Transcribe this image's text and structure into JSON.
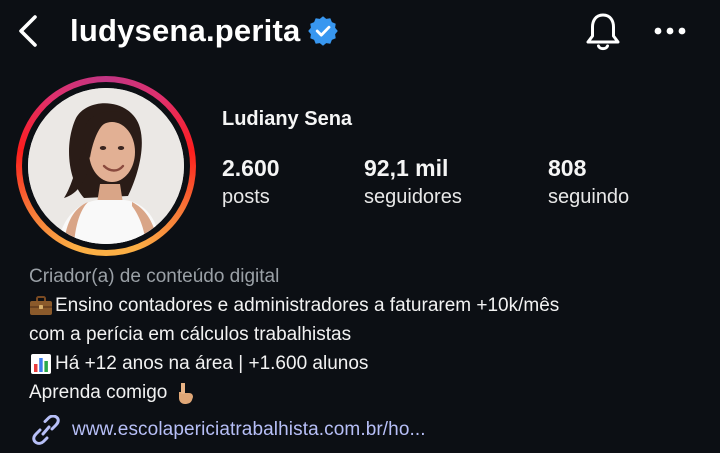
{
  "header": {
    "username": "ludysena.perita",
    "verified": true,
    "icons": [
      "back-arrow-icon",
      "verified-badge-icon",
      "bell-icon",
      "more-options-icon"
    ]
  },
  "profile": {
    "display_name": "Ludiany Sena",
    "stats": {
      "posts": {
        "value": "2.600",
        "label": "posts"
      },
      "followers": {
        "value": "92,1 mil",
        "label": "seguidores"
      },
      "following": {
        "value": "808",
        "label": "seguindo"
      }
    }
  },
  "bio": {
    "category": "Criador(a) de conteúdo digital",
    "lines": [
      {
        "emoji": "briefcase-icon",
        "text": "Ensino contadores e administradores a faturarem +10k/mês"
      },
      {
        "emoji": "",
        "text": "com a perícia em cálculos trabalhistas"
      },
      {
        "emoji": "bar-chart-icon",
        "text": "Há +12 anos na área | +1.600 alunos"
      },
      {
        "emoji": "",
        "text": "Aprenda comigo"
      }
    ],
    "pointing_emoji": "pointing-down-icon",
    "link": "www.escolapericiatrabalhista.com.br/ho..."
  },
  "colors": {
    "background": "#0c0f14",
    "verified_blue": "#3897f0",
    "link": "#b7bff7",
    "category": "#9aa0a6"
  }
}
